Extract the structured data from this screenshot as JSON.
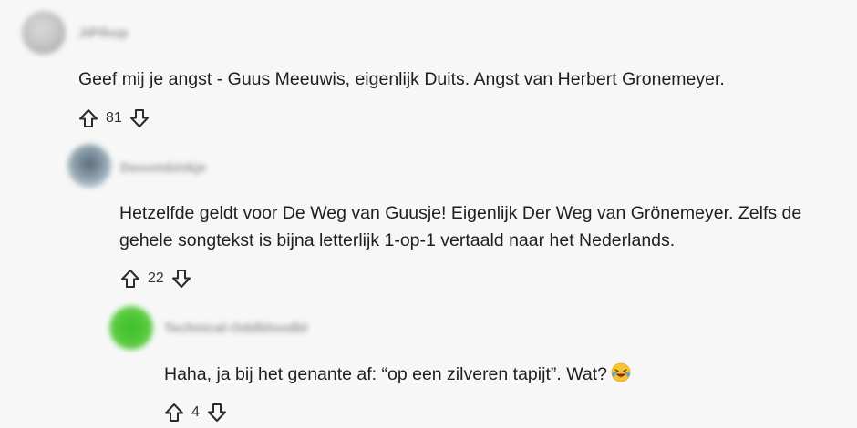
{
  "comments": [
    {
      "username": "JiPihop",
      "text_lines": [
        "Geef mij je angst - Guus Meeuwis, eigenlijk Duits. Angst van Herbert Gronemeyer."
      ],
      "votes": "81",
      "avatar_color": "#b9b9b9"
    },
    {
      "username": "Deoombinkje",
      "text_lines": [
        "Hetzelfde geldt voor De Weg van Guusje! Eigenlijk Der Weg van Grönemeyer. Zelfs de",
        "gehele songtekst is bijna letterlijk 1-op-1 vertaald naar het Nederlands."
      ],
      "votes": "22",
      "avatar_color": "#8c9aa6"
    },
    {
      "username": "Technical-Oddbloodbl",
      "text_lines": [
        "Haha, ja bij het genante af: “op een zilveren tapijt”. Wat?"
      ],
      "votes": "4",
      "avatar_color": "#5ac43a",
      "emoji": "grinning-squinting-face-with-tears-icon"
    }
  ]
}
